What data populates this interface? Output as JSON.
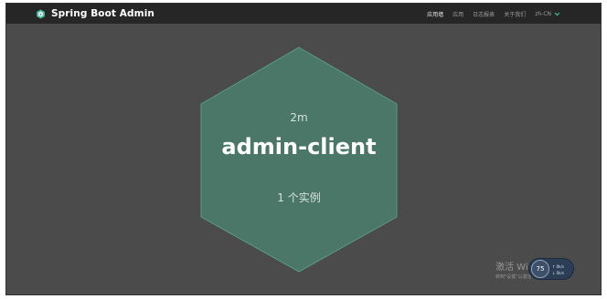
{
  "app": {
    "title": "Spring Boot Admin",
    "logo_icon": "spring-boot-admin-logo-icon",
    "accent_color": "#48be9f"
  },
  "nav": {
    "items": [
      {
        "label": "应用墙",
        "active": true
      },
      {
        "label": "应用",
        "active": false
      },
      {
        "label": "日志报表",
        "active": false
      },
      {
        "label": "关于我们",
        "active": false
      }
    ],
    "language": {
      "value": "zh-CN",
      "icon": "chevron-down-icon"
    }
  },
  "applications": [
    {
      "name": "admin-client",
      "time_since": "2m",
      "instances": "1 个实例",
      "status_color": "#4a7768"
    }
  ],
  "overlay": {
    "activation_title": "激活 Windows",
    "activation_sub": "转到\"设置\"以激活 Windows。",
    "network_widget": {
      "gauge": "75",
      "upload": "0k/s",
      "download": "0k/s"
    }
  }
}
